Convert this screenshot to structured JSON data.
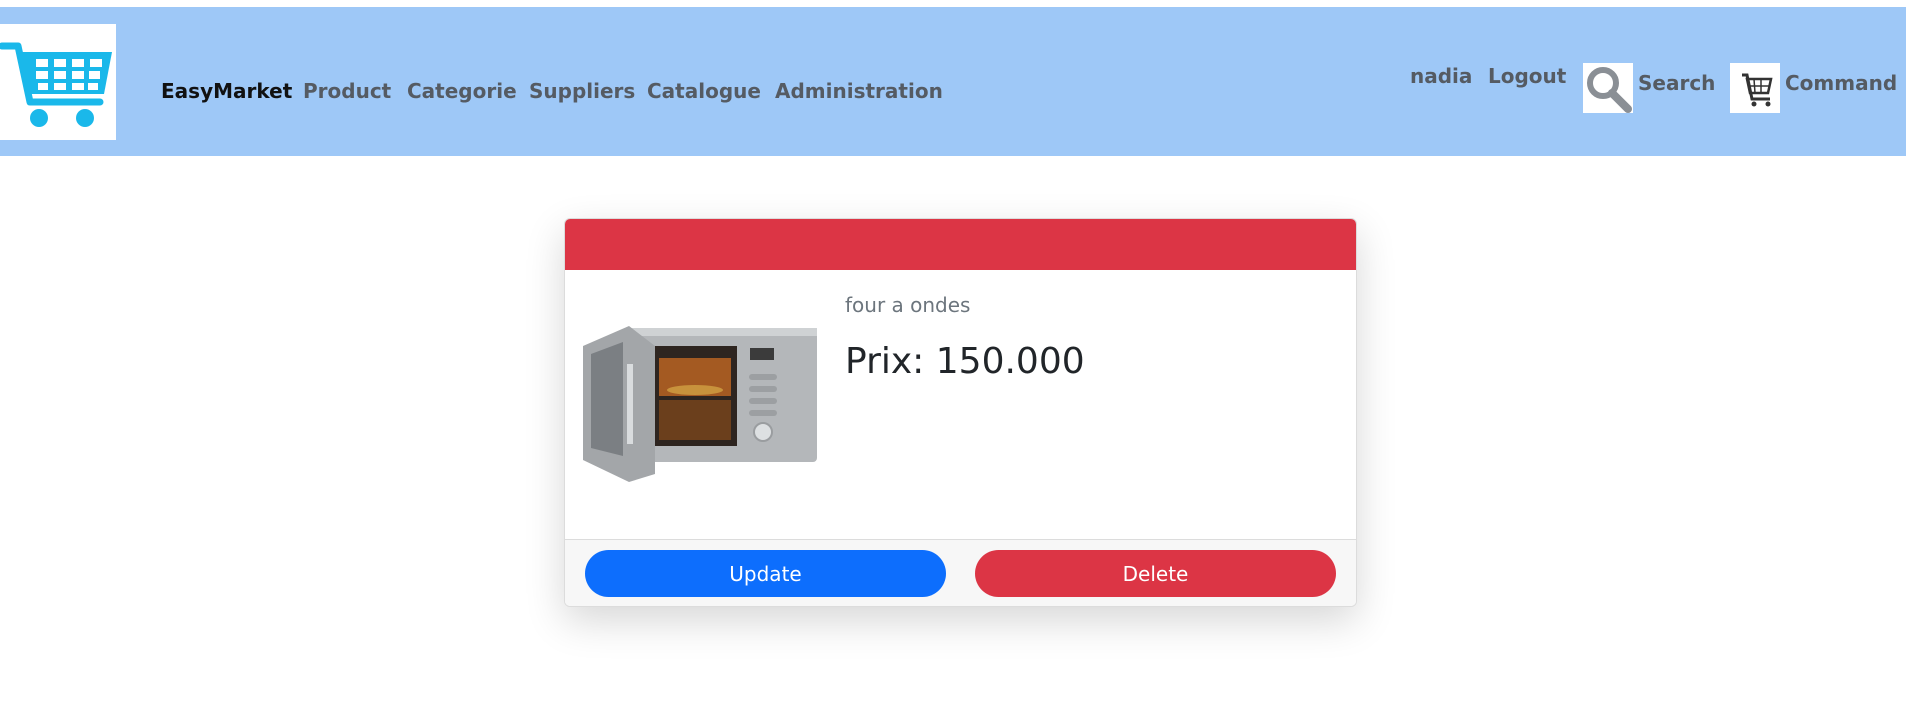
{
  "header": {
    "brand": "EasyMarket",
    "nav": [
      "Product",
      "Categorie",
      "Suppliers",
      "Catalogue",
      "Administration"
    ],
    "user": "nadia",
    "logout": "Logout",
    "search": "Search",
    "command": "Command",
    "colors": {
      "navbar_bg": "#9ec8f7",
      "logo_cart": "#1ab8ea"
    }
  },
  "product": {
    "name": "four a ondes",
    "price": "Prix: 150.000",
    "image_icon": "microwave-image"
  },
  "actions": {
    "update": "Update",
    "delete": "Delete",
    "colors": {
      "update": "#0d6efd",
      "delete": "#dc3545",
      "card_header": "#dc3545"
    }
  }
}
